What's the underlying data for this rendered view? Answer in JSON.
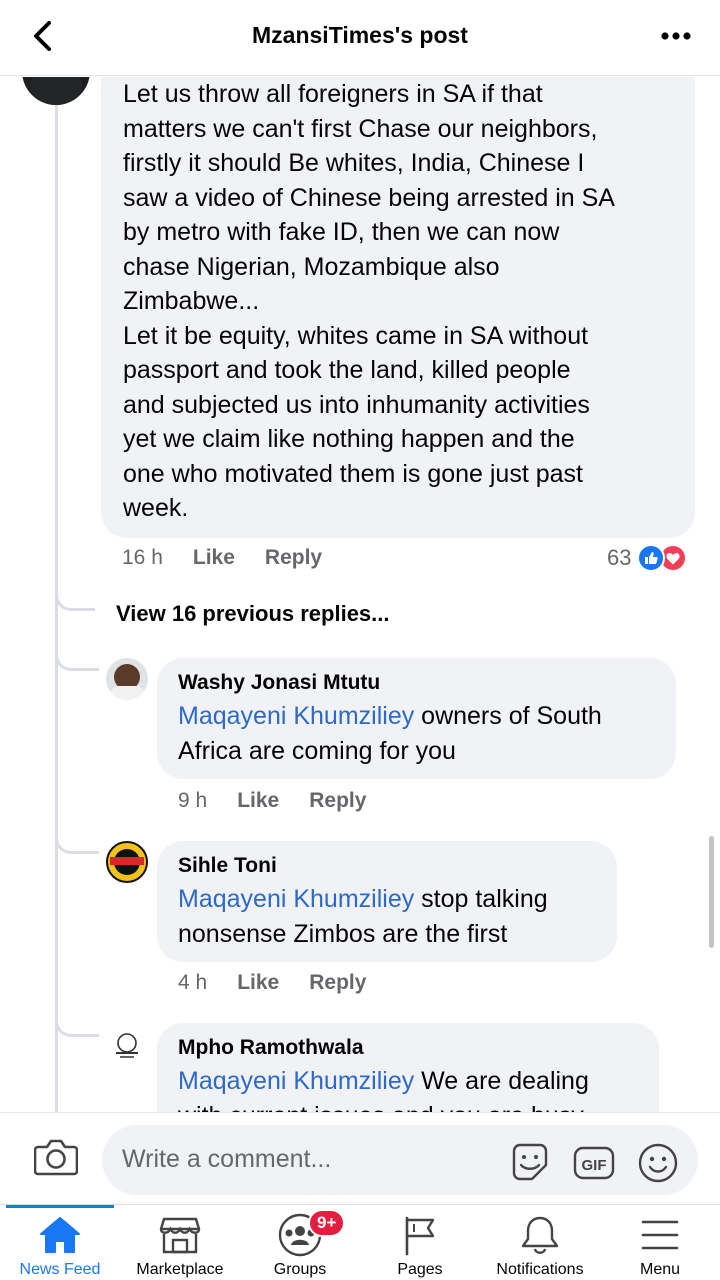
{
  "header": {
    "title": "MzansiTimes's post"
  },
  "comments": {
    "main": {
      "text_lines": [
        "Let us throw all foreigners in SA if that",
        "matters we can't first Chase our neighbors,",
        "firstly it should Be whites, India, Chinese I",
        "saw a video of Chinese being arrested in SA",
        "by metro with fake ID, then we can now",
        "chase Nigerian, Mozambique also",
        "Zimbabwe...",
        "Let it be equity, whites came in SA without",
        "passport and took the land, killed people",
        "and subjected us into inhumanity activities",
        "yet we claim like nothing happen and the",
        "one who motivated them is gone just past",
        "week."
      ],
      "time": "16 h",
      "like_label": "Like",
      "reply_label": "Reply",
      "reaction_count": "63",
      "reaction_icons": [
        "like-icon",
        "love-icon"
      ]
    },
    "view_previous": "View 16 previous replies...",
    "replies": [
      {
        "author": "Washy Jonasi Mtutu",
        "mention": "Maqayeni Khumziliey",
        "line1_rest": " owners of South",
        "line2": "Africa are coming for you",
        "time": "9 h",
        "like_label": "Like",
        "reply_label": "Reply"
      },
      {
        "author": "Sihle Toni",
        "mention": "Maqayeni Khumziliey",
        "line1_rest": " stop talking",
        "line2": "nonsense Zimbos are the first",
        "time": "4 h",
        "like_label": "Like",
        "reply_label": "Reply"
      },
      {
        "author": "Mpho Ramothwala",
        "mention": "Maqayeni Khumziliey",
        "line1_rest": " We are dealing",
        "line2": "with current issues and you are busy"
      }
    ]
  },
  "composer": {
    "placeholder": "Write a comment..."
  },
  "tabs": [
    {
      "label": "News Feed",
      "icon": "home-icon",
      "active": true
    },
    {
      "label": "Marketplace",
      "icon": "marketplace-icon"
    },
    {
      "label": "Groups",
      "icon": "groups-icon",
      "badge": "9+"
    },
    {
      "label": "Pages",
      "icon": "flag-icon"
    },
    {
      "label": "Notifications",
      "icon": "bell-icon"
    },
    {
      "label": "Menu",
      "icon": "menu-icon"
    }
  ],
  "colors": {
    "accent": "#1877f2",
    "mention": "#2d69c8",
    "badge": "#e41e3f",
    "bubble": "#f0f2f5"
  }
}
